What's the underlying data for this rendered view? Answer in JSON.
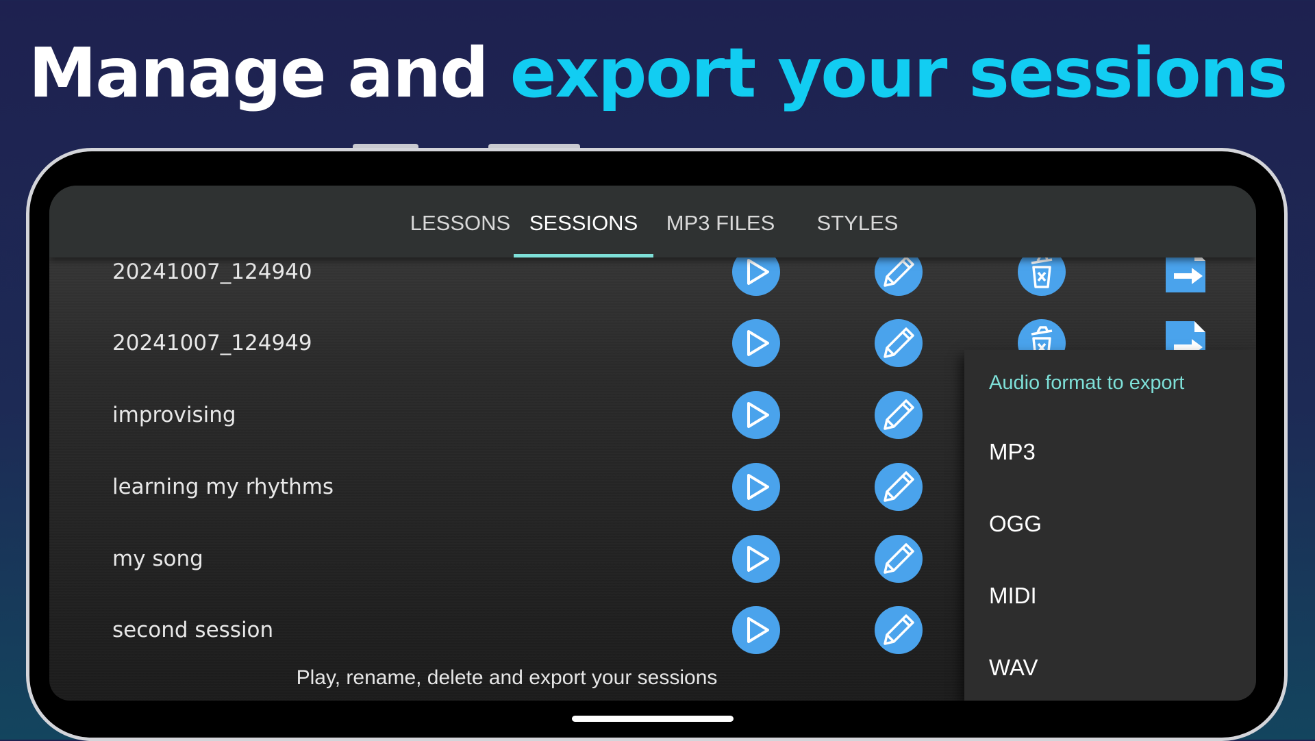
{
  "headline": {
    "white": "Manage and",
    "accent": "export your sessions"
  },
  "tabs": [
    {
      "label": "LESSONS"
    },
    {
      "label": "SESSIONS"
    },
    {
      "label": "MP3 FILES"
    },
    {
      "label": "STYLES"
    }
  ],
  "active_tab": "SESSIONS",
  "sessions": [
    {
      "name": "20241007_124940"
    },
    {
      "name": "20241007_124949"
    },
    {
      "name": "improvising"
    },
    {
      "name": "learning my rhythms"
    },
    {
      "name": "my song"
    },
    {
      "name": "second session"
    }
  ],
  "export_menu": {
    "title": "Audio format to export",
    "options": [
      "MP3",
      "OGG",
      "MIDI",
      "WAV"
    ]
  },
  "footer_text": "Play, rename, delete and export your sessions",
  "colors": {
    "accent_headline": "#12cdf2",
    "icon_blue": "#4aa3ec",
    "tab_indicator": "#7ee0d8"
  }
}
